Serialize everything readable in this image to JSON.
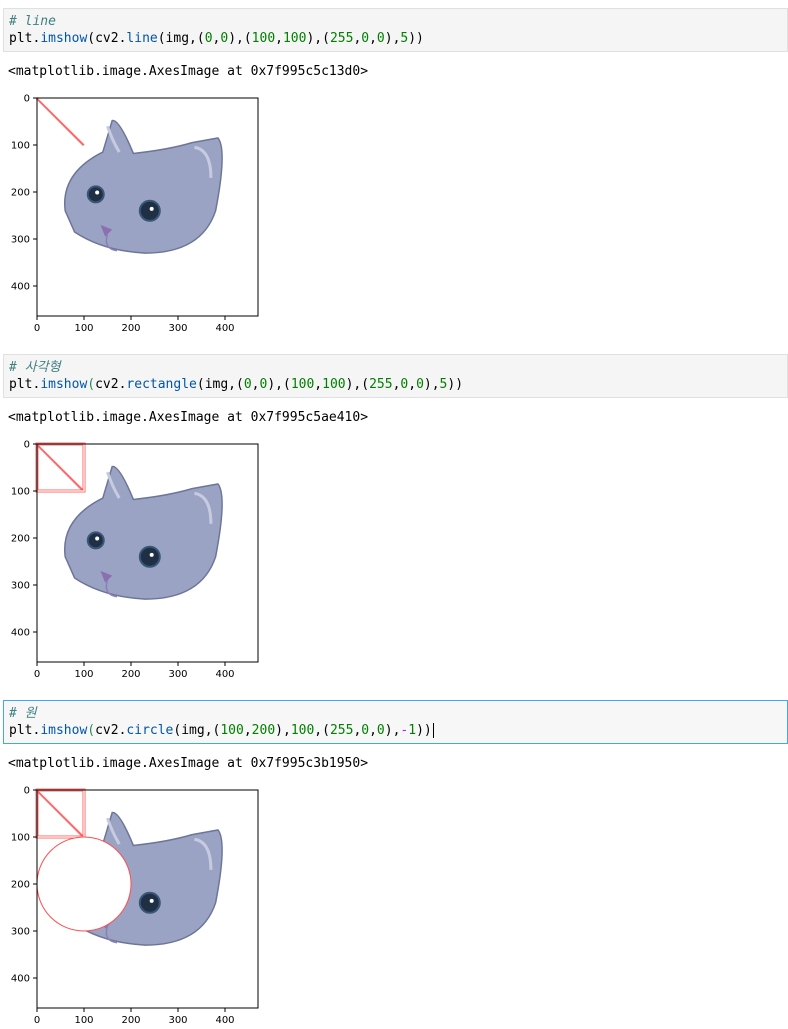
{
  "cells": [
    {
      "comment": "# line",
      "code": {
        "obj": "plt",
        "func": "imshow",
        "mod": "cv2",
        "inner": "line",
        "args_text": "(img,(0,0),(100,100),(255,0,0),5))"
      },
      "output": "<matplotlib.image.AxesImage at 0x7f995c5c13d0>",
      "annotation": "line",
      "active": false
    },
    {
      "comment": "# 사각형",
      "code": {
        "obj": "plt",
        "func": "imshow",
        "mod": "cv2",
        "inner": "rectangle",
        "args_text": "(img,(0,0),(100,100),(255,0,0),5))"
      },
      "output": "<matplotlib.image.AxesImage at 0x7f995c5ae410>",
      "annotation": "rectangle",
      "active": false
    },
    {
      "comment": "# 원",
      "code": {
        "obj": "plt",
        "func": "imshow",
        "mod": "cv2",
        "inner": "circle",
        "args_text": "(img,(100,200),100,(255,0,0),-1))"
      },
      "output": "<matplotlib.image.AxesImage at 0x7f995c3b1950>",
      "annotation": "circle",
      "active": true
    }
  ],
  "axes": {
    "xticks": [
      "0",
      "100",
      "200",
      "300",
      "400"
    ],
    "yticks": [
      "0",
      "100",
      "200",
      "300",
      "400"
    ]
  },
  "colors": {
    "line": "#ff4d4d",
    "cat_fur": "#9aa3c4",
    "cat_shadow": "#6d7698",
    "eye": "#1f2f44"
  }
}
